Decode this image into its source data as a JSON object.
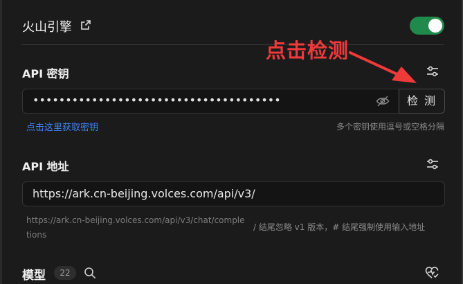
{
  "provider": {
    "name": "火山引擎",
    "enabled": true,
    "accent_color": "#1f8a4c"
  },
  "annotation": {
    "text": "点击检测",
    "color": "#ef3a3a"
  },
  "api_key": {
    "label": "API 密钥",
    "value": "••••••••••••••••••••••••••••••••••••••",
    "check_button": "检 测",
    "get_key_link": "点击这里获取密钥",
    "hint": "多个密钥使用逗号或空格分隔"
  },
  "api_url": {
    "label": "API 地址",
    "value": "https://ark.cn-beijing.volces.com/api/v3/",
    "preview": "https://ark.cn-beijing.volces.com/api/v3/chat/completions",
    "hint": "/ 结尾忽略 v1 版本，# 结尾强制使用输入地址"
  },
  "models": {
    "label": "模型",
    "count": "22"
  }
}
